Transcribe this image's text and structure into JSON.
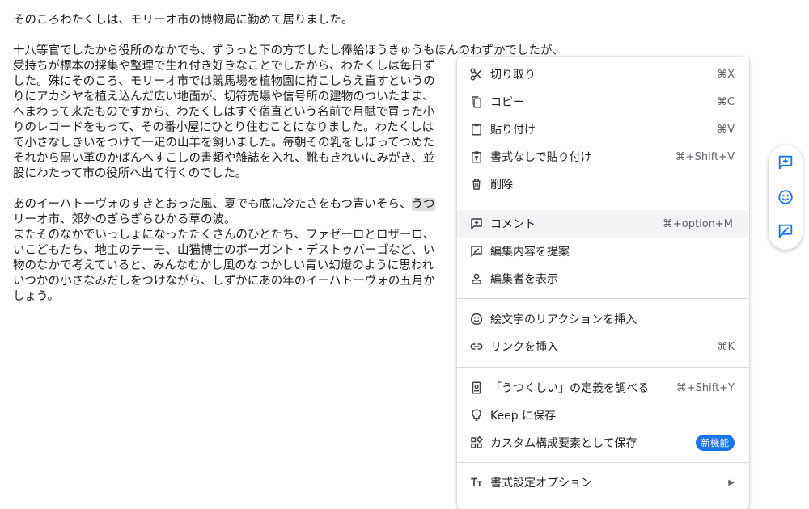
{
  "document": {
    "paragraph1": "そのころわたくしは、モリーオ市の博物局に勤めて居りました。",
    "paragraph2": [
      "十八等官でしたから役所のなかでも、ずうっと下の方でしたし俸給ほうきゅうもほんのわずかでしたが、",
      "受持ちが標本の採集や整理で生れ付き好きなことでしたから、わたくしは毎日ず",
      "した。殊にそのころ、モリーオ市では競馬場を植物園に拵こしらえ直すというの",
      "りにアカシヤを植え込んだ広い地面が、切符売場や信号所の建物のついたまま、",
      "へまわって来たものですから、わたくしはすぐ宿直という名前で月賦で買った小",
      "りのレコードをもって、その番小屋にひとり住むことになりました。わたくしは",
      "で小さなしきいをつけて一疋の山羊を飼いました。毎朝その乳をしぼってつめた",
      "それから黒い革のかばんへすこしの書類や雑誌を入れ、靴もきれいにみがき、並",
      "股にわたって市の役所へ出て行くのでした。"
    ],
    "paragraph3_line1_before": "あのイーハトーヴォのすきとおった風、夏でも底に冷たさをもつ青いそら、",
    "paragraph3_line1_selected": "うつ",
    "paragraph3": [
      "リーオ市、郊外のぎらぎらひかる草の波。",
      "またそのなかでいっしょになったたくさんのひとたち、ファゼーロとロザーロ、",
      "いこどもたち、地主のテーモ、山猫博士のボーガント・デストゥパーゴなど、い",
      "物のなかで考えていると、みんなむかし風のなつかしい青い幻燈のように思われ",
      "いつかの小さなみだしをつけながら、しずかにあの年のイーハトーヴォの五月か",
      "しょう。"
    ]
  },
  "context_menu": {
    "cut": {
      "label": "切り取り",
      "shortcut": "⌘X",
      "icon": "scissors-icon"
    },
    "copy": {
      "label": "コピー",
      "shortcut": "⌘C",
      "icon": "copy-icon"
    },
    "paste": {
      "label": "貼り付け",
      "shortcut": "⌘V",
      "icon": "clipboard-icon"
    },
    "paste_plain": {
      "label": "書式なしで貼り付け",
      "shortcut": "⌘+Shift+V",
      "icon": "paste-plain-icon"
    },
    "delete": {
      "label": "削除",
      "icon": "trash-icon"
    },
    "comment": {
      "label": "コメント",
      "shortcut": "⌘+option+M",
      "icon": "add-comment-icon"
    },
    "suggest": {
      "label": "編集内容を提案",
      "icon": "suggest-edit-icon"
    },
    "editors": {
      "label": "編集者を表示",
      "icon": "person-icon"
    },
    "emoji": {
      "label": "絵文字のリアクションを挿入",
      "icon": "emoji-icon"
    },
    "link": {
      "label": "リンクを挿入",
      "shortcut": "⌘K",
      "icon": "link-icon"
    },
    "define": {
      "label": "「うつくしい」の定義を調べる",
      "shortcut": "⌘+Shift+Y",
      "icon": "dictionary-icon"
    },
    "keep": {
      "label": "Keep に保存",
      "icon": "lightbulb-icon"
    },
    "building_block": {
      "label": "カスタム構成要素として保存",
      "badge": "新機能",
      "icon": "blocks-icon"
    },
    "format": {
      "label": "書式設定オプション",
      "icon": "text-format-icon"
    }
  },
  "colors": {
    "accent": "#1a73e8",
    "hover": "#f1f3f4",
    "selection": "#dcdcdc"
  }
}
